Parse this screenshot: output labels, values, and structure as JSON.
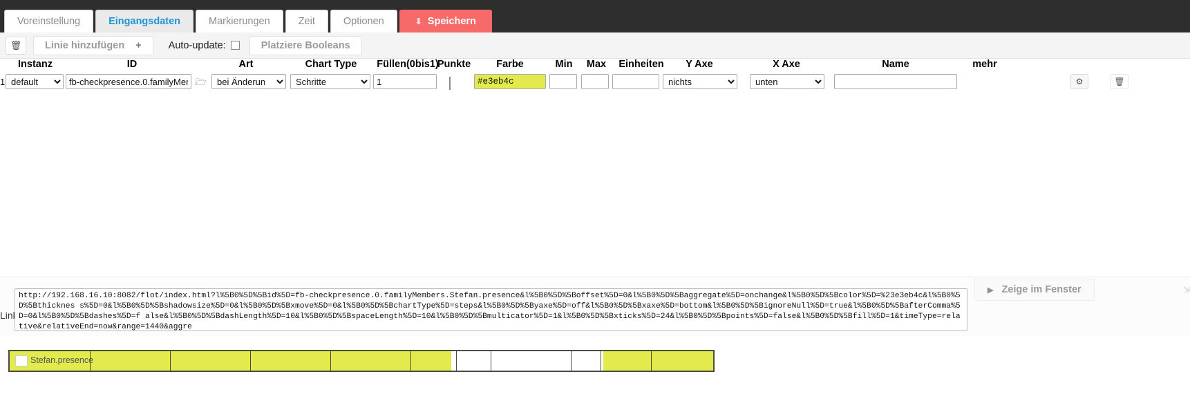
{
  "tabs": [
    {
      "label": "Voreinstellung",
      "active": false
    },
    {
      "label": "Eingangsdaten",
      "active": true
    },
    {
      "label": "Markierungen",
      "active": false
    },
    {
      "label": "Zeit",
      "active": false
    },
    {
      "label": "Optionen",
      "active": false
    }
  ],
  "save_tab": {
    "label": "Speichern",
    "icon": "download-icon",
    "color": "#f76a6a"
  },
  "toolbar": {
    "delete_icon": "trash-icon",
    "add_line_label": "Linie hinzufügen",
    "add_line_plus": "+",
    "auto_update_label": "Auto-update:",
    "auto_update_checked": false,
    "place_booleans_label": "Platziere Booleans"
  },
  "columns": [
    {
      "key": "instanz",
      "label": "Instanz"
    },
    {
      "key": "id",
      "label": "ID"
    },
    {
      "key": "art",
      "label": "Art"
    },
    {
      "key": "charttype",
      "label": "Chart Type"
    },
    {
      "key": "fuellen",
      "label": "Füllen(0bis1)"
    },
    {
      "key": "punkte",
      "label": "Punkte"
    },
    {
      "key": "farbe",
      "label": "Farbe"
    },
    {
      "key": "min",
      "label": "Min"
    },
    {
      "key": "max",
      "label": "Max"
    },
    {
      "key": "einheiten",
      "label": "Einheiten"
    },
    {
      "key": "yaxe",
      "label": "Y Axe"
    },
    {
      "key": "xaxe",
      "label": "X Axe"
    },
    {
      "key": "name",
      "label": "Name"
    },
    {
      "key": "mehr",
      "label": "mehr"
    }
  ],
  "row": {
    "number": "1",
    "instanz": "default",
    "id": "fb-checkpresence.0.familyMer",
    "id_browse_icon": "folder-icon",
    "art": "bei Änderung",
    "charttype": "Schritte",
    "fuellen": "1",
    "punkte_checked": false,
    "farbe": "#e3eb4c",
    "min": "",
    "max": "",
    "einheiten": "",
    "yaxe": "nichts",
    "xaxe": "unten",
    "name": "",
    "settings_icon": "gear-icon",
    "delete_icon": "trash-icon"
  },
  "link": {
    "label": "Link",
    "url": "http://192.168.16.10:8082/flot/index.html?l%5B0%5D%5Bid%5D=fb-checkpresence.0.familyMembers.Stefan.presence&l%5B0%5D%5Boffset%5D=0&l%5B0%5D%5Baggregate%5D=onchange&l%5B0%5D%5Bcolor%5D=%23e3eb4c&l%5B0%5D%5Bthicknes s%5D=0&l%5B0%5D%5Bshadowsize%5D=0&l%5B0%5D%5Bxmove%5D=0&l%5B0%5D%5BchartType%5D=steps&l%5B0%5D%5Byaxe%5D=off&l%5B0%5D%5Bxaxe%5D=bottom&l%5B0%5D%5BignoreNull%5D=true&l%5B0%5D%5BafterComma%5D=0&l%5B0%5D%5Bdashes%5D=f alse&l%5B0%5D%5BdashLength%5D=10&l%5B0%5D%5BspaceLength%5D=10&l%5B0%5D%5Bmulticator%5D=1&l%5B0%5D%5Bxticks%5D=24&l%5B0%5D%5Bpoints%5D=false&l%5B0%5D%5Bfill%5D=1&timeType=relative&relativeEnd=now&range=1440&aggre",
    "show_window_label": "Zeige im Fenster",
    "play_icon": "play-icon",
    "resize_icon": "resize-handle-icon"
  },
  "chart_data": {
    "type": "area",
    "title": "",
    "xlabel": "",
    "ylabel": "",
    "ylim": [
      0,
      1
    ],
    "grid": true,
    "legend_position": "top-left",
    "series": [
      {
        "name": "Stefan.presence",
        "color": "#e3eb4c",
        "values": [
          1,
          1,
          1,
          1,
          1,
          1,
          0,
          0,
          0,
          0,
          0,
          1,
          1,
          1
        ]
      }
    ],
    "segments": [
      {
        "start_pct": 0.0,
        "end_pct": 62.8,
        "value": 1
      },
      {
        "start_pct": 62.8,
        "end_pct": 84.4,
        "value": 0
      },
      {
        "start_pct": 84.4,
        "end_pct": 100.0,
        "value": 1
      }
    ],
    "gridlines_pct": [
      11.4,
      22.8,
      34.2,
      45.6,
      57.0,
      63.5,
      68.4,
      79.8,
      84.0,
      91.2
    ]
  }
}
